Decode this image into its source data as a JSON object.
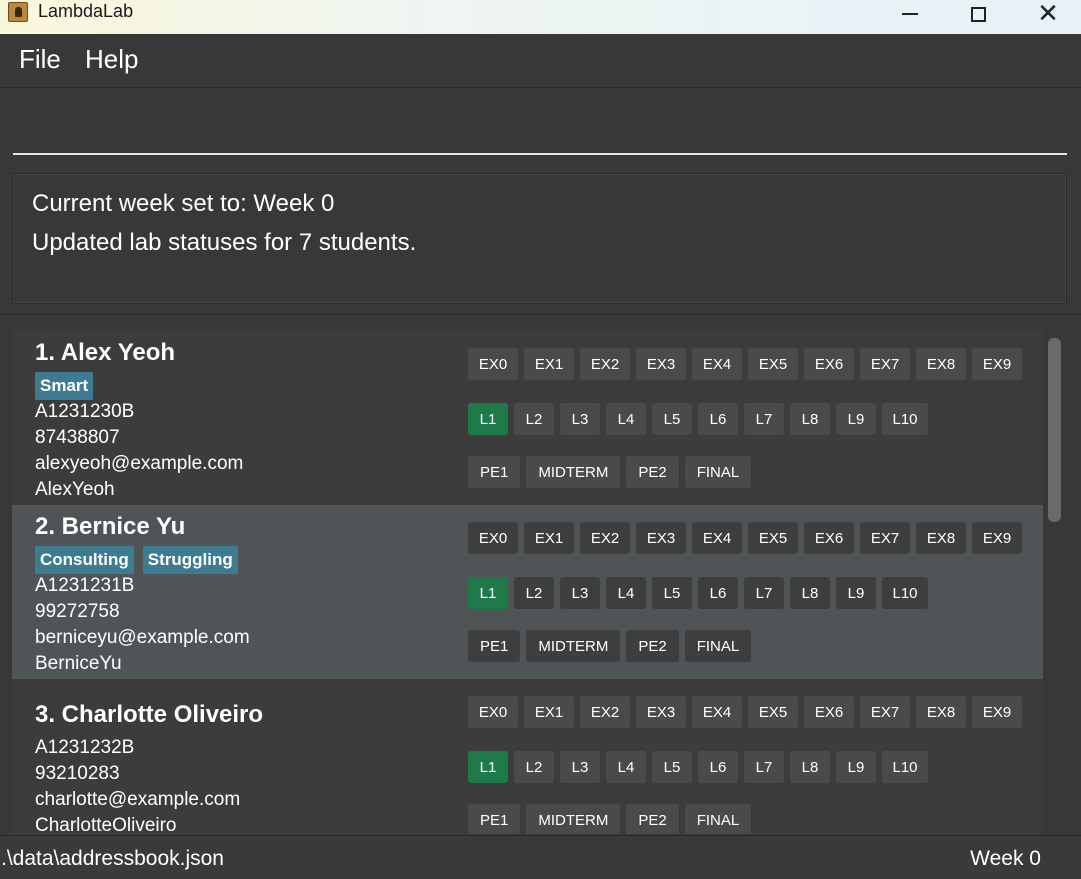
{
  "window": {
    "title": "LambdaLab"
  },
  "menu": {
    "file": "File",
    "help": "Help"
  },
  "command": {
    "value": "",
    "placeholder": ""
  },
  "result": {
    "line1": "Current week set to: Week 0",
    "line2": "Updated lab statuses for 7 students."
  },
  "persons": [
    {
      "name": "1. Alex Yeoh",
      "tags": [
        "Smart"
      ],
      "student_id": "A1231230B",
      "phone": "87438807",
      "email": "alexyeoh@example.com",
      "github": "AlexYeoh"
    },
    {
      "name": "2. Bernice Yu",
      "tags": [
        "Consulting",
        "Struggling"
      ],
      "student_id": "A1231231B",
      "phone": "99272758",
      "email": "berniceyu@example.com",
      "github": "BerniceYu"
    },
    {
      "name": "3. Charlotte Oliveiro",
      "tags": [],
      "student_id": "A1231232B",
      "phone": "93210283",
      "email": "charlotte@example.com",
      "github": "CharlotteOliveiro"
    }
  ],
  "exercises": [
    "EX0",
    "EX1",
    "EX2",
    "EX3",
    "EX4",
    "EX5",
    "EX6",
    "EX7",
    "EX8",
    "EX9"
  ],
  "labs": [
    "L1",
    "L2",
    "L3",
    "L4",
    "L5",
    "L6",
    "L7",
    "L8",
    "L9",
    "L10"
  ],
  "exams": [
    "PE1",
    "MIDTERM",
    "PE2",
    "FINAL"
  ],
  "colors": {
    "done": "#1f7a4a",
    "tag": "#3e7b91",
    "background": "#383838",
    "selected": "#4f5456"
  },
  "status": {
    "path": ".\\data\\addressbook.json",
    "week": "Week 0"
  }
}
